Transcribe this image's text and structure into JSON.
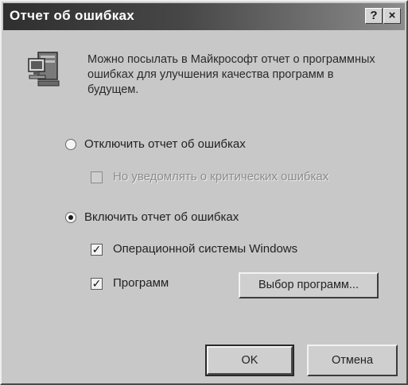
{
  "window": {
    "title": "Отчет об ошибках"
  },
  "titlebar": {
    "help_label": "?",
    "close_label": "×"
  },
  "icons": {
    "app": "computer-icon"
  },
  "description": "Можно посылать в Майкрософт отчет о программных ошибках для улучшения качества программ в будущем.",
  "options": {
    "disable_label": "Отключить отчет об ошибках",
    "disable_selected": false,
    "notify_critical_label": "Но уведомлять о критических ошибках",
    "notify_critical_checked": false,
    "notify_critical_enabled": false,
    "enable_label": "Включить отчет об ошибках",
    "enable_selected": true,
    "os_label": "Операционной системы Windows",
    "os_checked": true,
    "programs_label": "Программ",
    "programs_checked": true,
    "choose_programs_label": "Выбор программ..."
  },
  "buttons": {
    "ok_label": "OK",
    "cancel_label": "Отмена"
  }
}
